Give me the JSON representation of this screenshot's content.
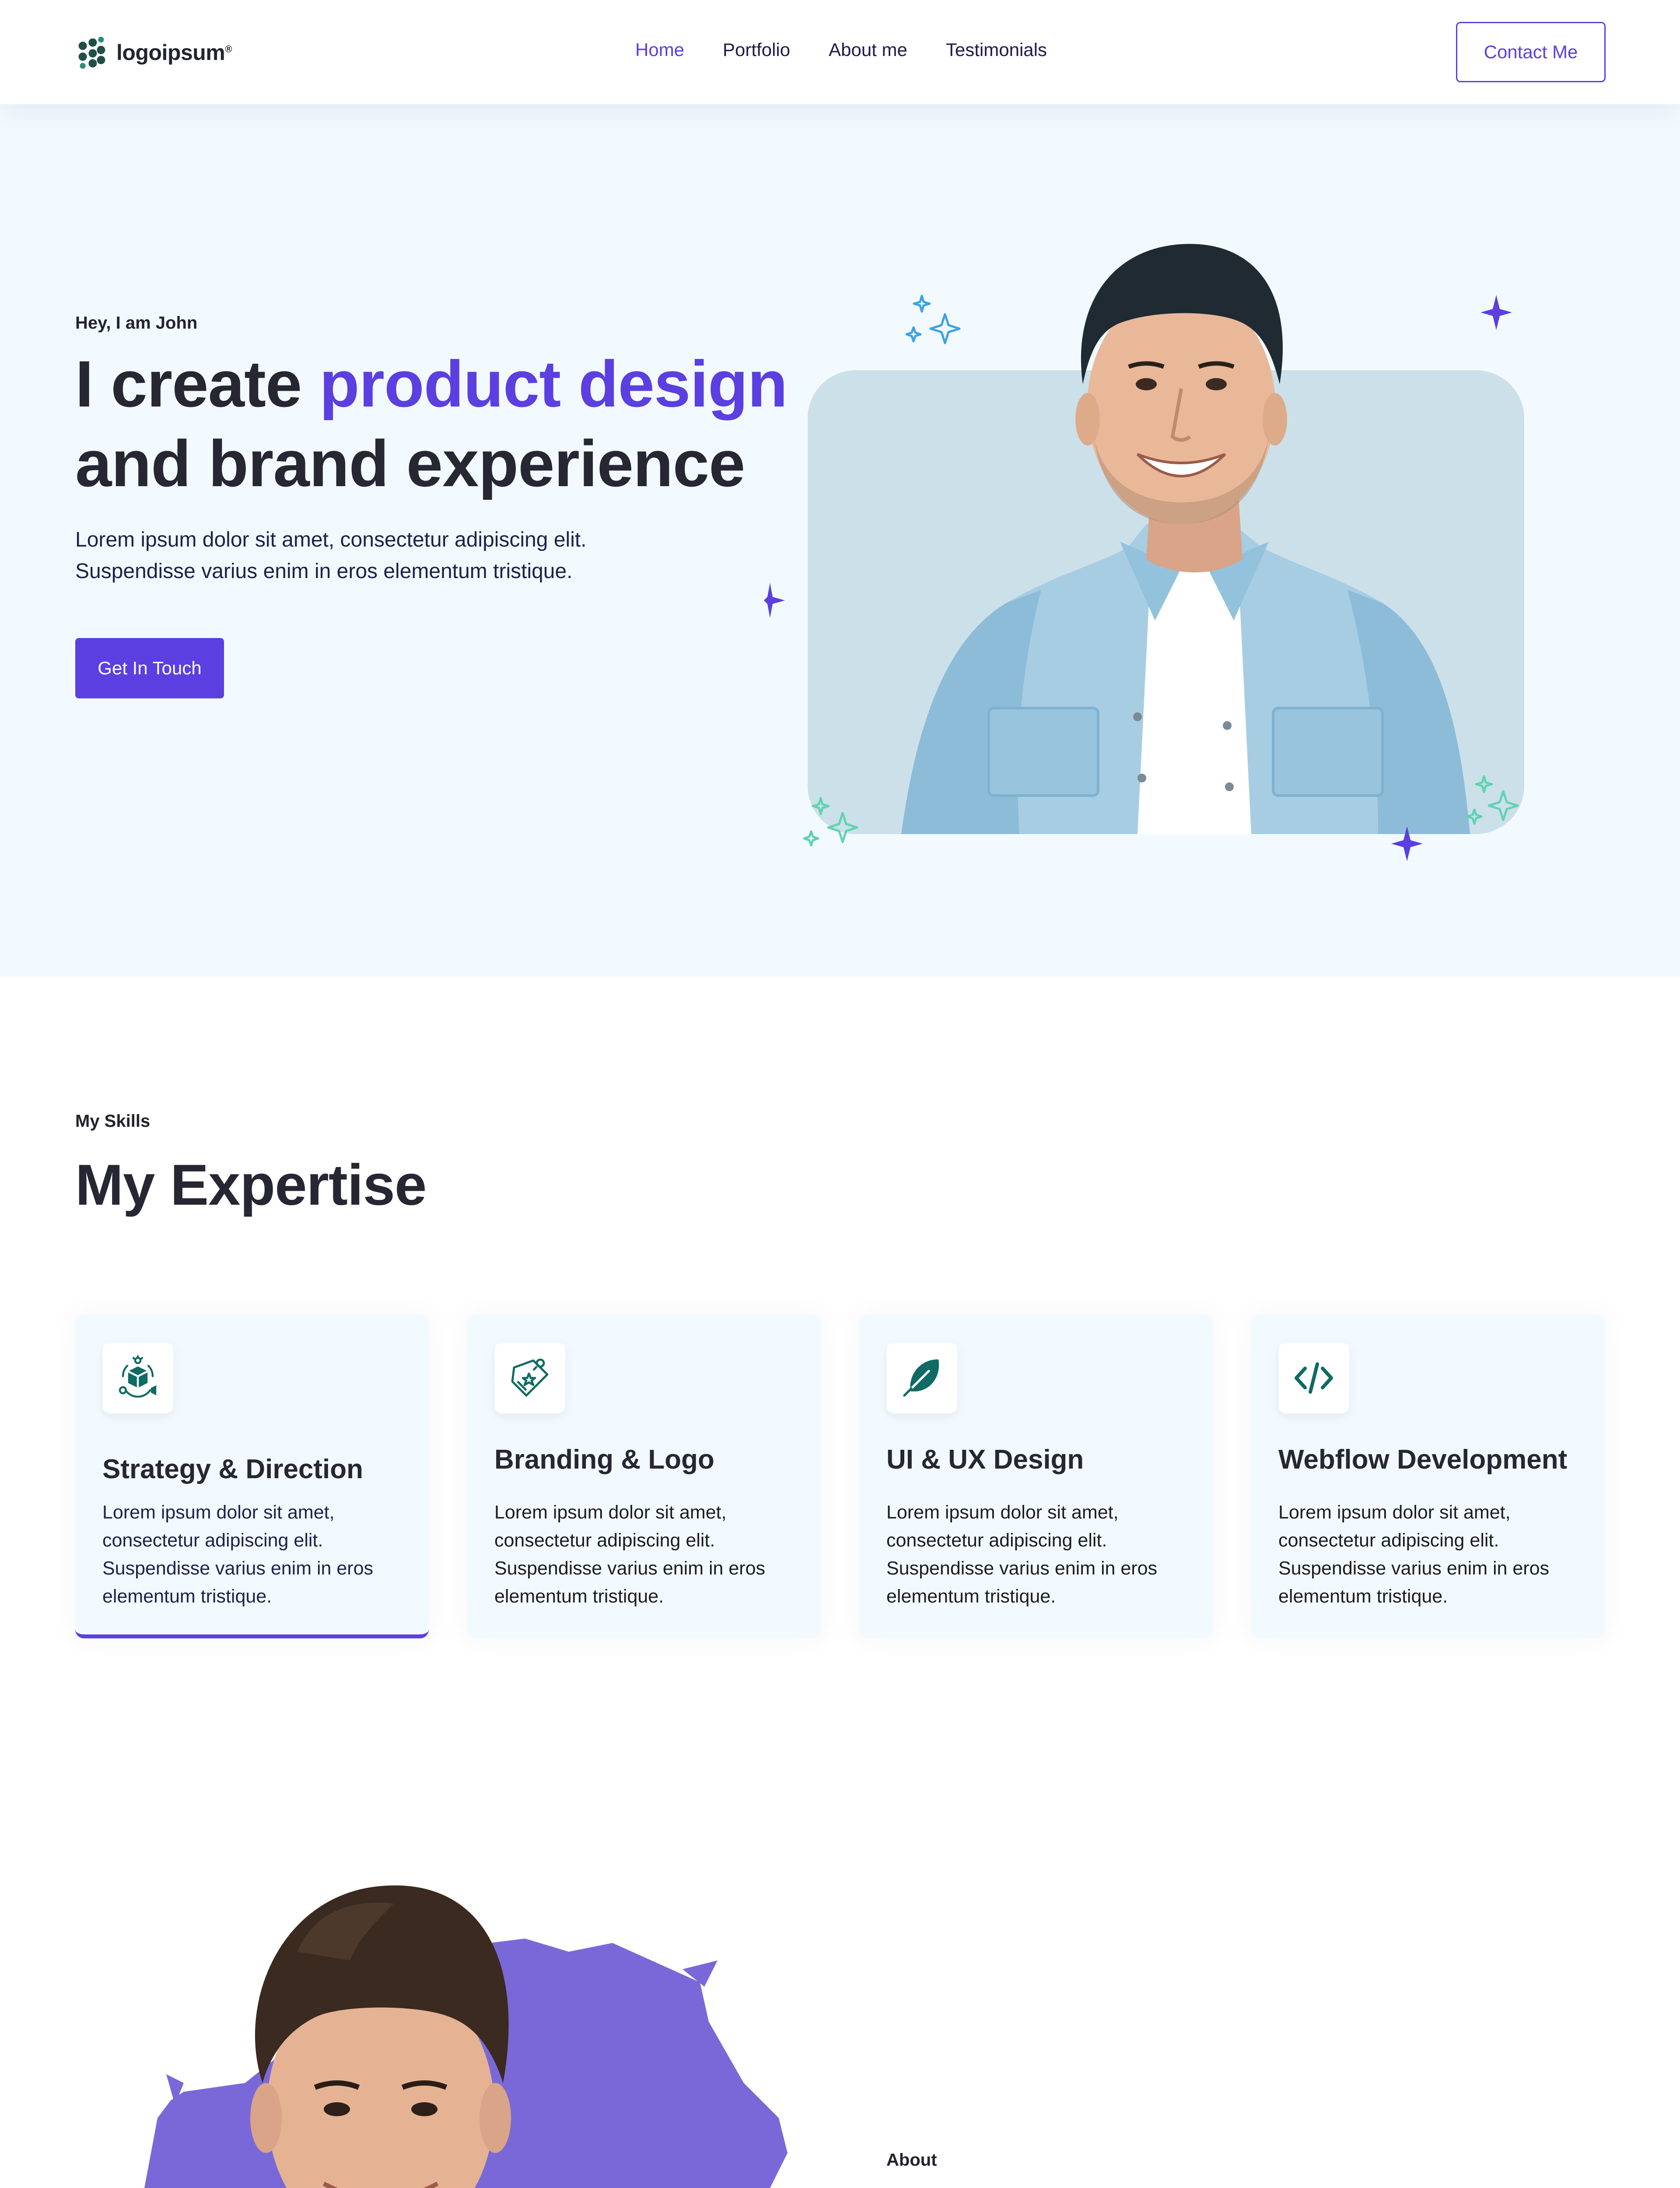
{
  "nav": {
    "logo_text": "logoipsum",
    "logo_mark": "®",
    "links": [
      "Home",
      "Portfolio",
      "About me",
      "Testimonials"
    ],
    "active_link": "Home",
    "contact_label": "Contact Me"
  },
  "hero": {
    "greeting": "Hey, I am John",
    "title_line1_plain": "I create ",
    "title_line1_accent": "product design",
    "title_line2": "and brand experience",
    "desc_line1": "Lorem ipsum dolor sit amet, consectetur adipiscing elit.",
    "desc_line2": "Suspendisse varius enim in eros elementum tristique.",
    "cta_label": "Get In Touch"
  },
  "skills": {
    "kicker": "My Skills",
    "title": "My Expertise",
    "cards": [
      {
        "title": "Strategy & Direction",
        "text": "Lorem ipsum dolor sit amet, consectetur adipiscing elit. Suspendisse varius enim in eros elementum tristique.",
        "icon": "strategy-icon"
      },
      {
        "title": "Branding & Logo",
        "text": "Lorem ipsum dolor sit amet, consectetur adipiscing elit. Suspendisse varius enim in eros elementum tristique.",
        "icon": "price-tag-icon"
      },
      {
        "title": "UI & UX Design",
        "text": "Lorem ipsum dolor sit amet, consectetur adipiscing elit. Suspendisse varius enim in eros elementum tristique.",
        "icon": "feather-icon"
      },
      {
        "title": "Webflow Development",
        "text": "Lorem ipsum dolor sit amet, consectetur adipiscing elit. Suspendisse varius enim in eros elementum tristique.",
        "icon": "code-icon"
      }
    ]
  },
  "about": {
    "kicker": "About"
  },
  "colors": {
    "accent": "#5b3fe0",
    "hero_bg": "#f3faff",
    "photo_bg": "#cce0ea",
    "heading": "#262733",
    "icon_teal": "#0f6b63",
    "sparkle_blue": "#3aa3e6",
    "sparkle_green": "#5fd3b0",
    "about_blob": "#7b68d8"
  }
}
